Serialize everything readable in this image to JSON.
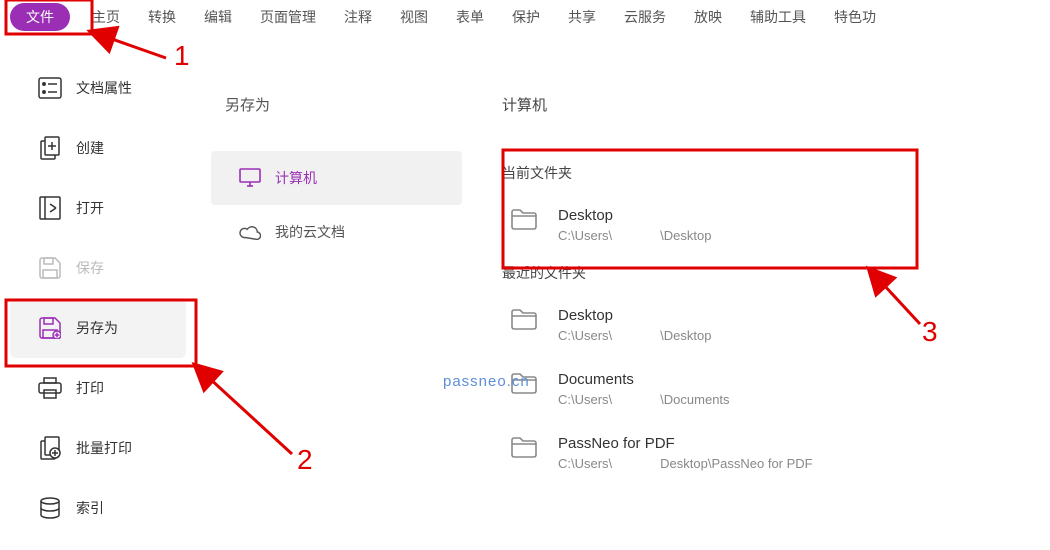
{
  "menubar": {
    "file": "文件",
    "items": [
      "主页",
      "转换",
      "编辑",
      "页面管理",
      "注释",
      "视图",
      "表单",
      "保护",
      "共享",
      "云服务",
      "放映",
      "辅助工具",
      "特色功"
    ]
  },
  "left": {
    "items": [
      {
        "label": "文档属性"
      },
      {
        "label": "创建"
      },
      {
        "label": "打开"
      },
      {
        "label": "保存"
      },
      {
        "label": "另存为"
      },
      {
        "label": "打印"
      },
      {
        "label": "批量打印"
      },
      {
        "label": "索引"
      }
    ]
  },
  "mid": {
    "title": "另存为",
    "items": [
      {
        "label": "计算机"
      },
      {
        "label": "我的云文档"
      }
    ]
  },
  "right": {
    "title": "计算机",
    "current_label": "当前文件夹",
    "recent_label": "最近的文件夹",
    "current": {
      "name": "Desktop",
      "path_a": "C:\\Users\\",
      "path_b": "\\Desktop"
    },
    "recent": [
      {
        "name": "Desktop",
        "path_a": "C:\\Users\\",
        "path_b": "\\Desktop"
      },
      {
        "name": "Documents",
        "path_a": "C:\\Users\\",
        "path_b": "\\Documents"
      },
      {
        "name": "PassNeo for PDF",
        "path_a": "C:\\Users\\",
        "path_b": "Desktop\\PassNeo for PDF"
      }
    ]
  },
  "watermark": "passneo.cn",
  "anno": {
    "n1": "1",
    "n2": "2",
    "n3": "3"
  }
}
